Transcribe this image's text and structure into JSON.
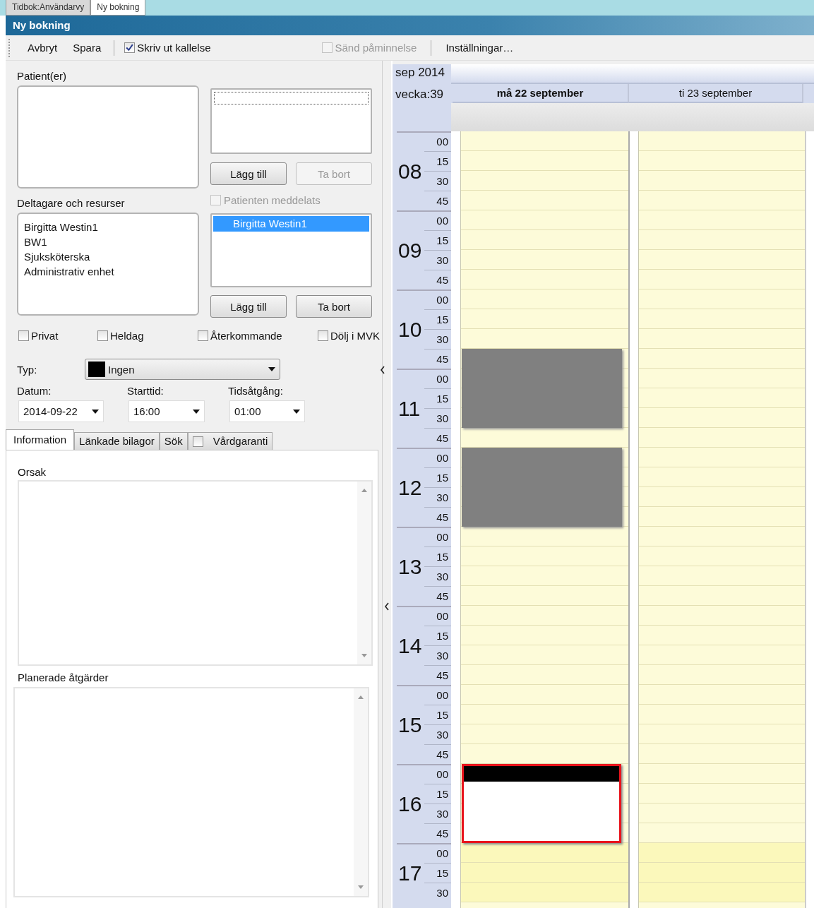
{
  "app_tabs": [
    {
      "label": "Tidbok:Användarvy",
      "selected": false
    },
    {
      "label": "Ny bokning",
      "selected": true
    }
  ],
  "window": {
    "title": "Ny bokning"
  },
  "toolbar": [
    {
      "kind": "button",
      "label": "Avbryt"
    },
    {
      "kind": "button",
      "label": "Spara"
    },
    {
      "kind": "separator"
    },
    {
      "kind": "checkbox",
      "label": "Skriv ut kallelse",
      "checked": true,
      "disabled": false
    },
    {
      "kind": "spacer"
    },
    {
      "kind": "checkbox",
      "label": "Sänd påminnelse",
      "checked": false,
      "disabled": true
    },
    {
      "kind": "separator"
    },
    {
      "kind": "button",
      "label": "Inställningar…"
    }
  ],
  "patients": {
    "label": "Patient(er)",
    "buttons": [
      {
        "label": "Lägg till",
        "disabled": false
      },
      {
        "label": "Ta bort",
        "disabled": true
      }
    ],
    "notified": {
      "label": "Patienten meddelats",
      "checked": false,
      "disabled": true
    }
  },
  "participants": {
    "label": "Deltagare och resurser",
    "details": [
      "Birgitta Westin1",
      "BW1",
      "Sjuksköterska",
      "Administrativ enhet"
    ],
    "list": [
      {
        "label": "Birgitta Westin1",
        "selected": true
      }
    ],
    "buttons": [
      {
        "label": "Lägg till",
        "disabled": false
      },
      {
        "label": "Ta bort",
        "disabled": false
      }
    ]
  },
  "options": [
    {
      "label": "Privat",
      "checked": false
    },
    {
      "label": "Heldag",
      "checked": false
    },
    {
      "label": "Återkommande",
      "checked": false
    },
    {
      "label": "Dölj i MVK",
      "checked": false
    }
  ],
  "type": {
    "label": "Typ:",
    "value": "Ingen",
    "color": "#000000"
  },
  "fields": [
    {
      "label": "Datum:",
      "value": "2014-09-22"
    },
    {
      "label": "Starttid:",
      "value": "16:00"
    },
    {
      "label": "Tidsåtgång:",
      "value": "01:00"
    }
  ],
  "detail_tabs": [
    {
      "kind": "tab",
      "label": "Information",
      "selected": true
    },
    {
      "kind": "tab",
      "label": "Länkade bilagor",
      "selected": false
    },
    {
      "kind": "tab",
      "label": "Sök",
      "selected": false
    },
    {
      "kind": "checkbox",
      "label": "Vårdgaranti",
      "selected": false,
      "checked": false
    }
  ],
  "text_areas": [
    {
      "label": "Orsak"
    },
    {
      "label": "Planerade åtgärder"
    }
  ],
  "calendar": {
    "month": "sep 2014",
    "week": "vecka:39",
    "days": [
      {
        "label": "må 22 september",
        "today": true,
        "slots": [
          {
            "kind": "free"
          },
          {
            "kind": "free"
          },
          {
            "kind": "free"
          },
          {
            "kind": "free"
          },
          {
            "kind": "free"
          },
          {
            "kind": "free"
          },
          {
            "kind": "free"
          },
          {
            "kind": "free"
          },
          {
            "kind": "free"
          },
          {
            "kind": "free"
          },
          {
            "kind": "free"
          },
          {
            "kind": "busy"
          },
          {
            "kind": "busy"
          },
          {
            "kind": "busy"
          },
          {
            "kind": "busy"
          },
          {
            "kind": "free"
          },
          {
            "kind": "busy"
          },
          {
            "kind": "busy"
          },
          {
            "kind": "busy"
          },
          {
            "kind": "busy"
          },
          {
            "kind": "free"
          },
          {
            "kind": "free"
          },
          {
            "kind": "free"
          },
          {
            "kind": "free"
          },
          {
            "kind": "free"
          },
          {
            "kind": "free"
          },
          {
            "kind": "free"
          },
          {
            "kind": "free"
          },
          {
            "kind": "free"
          },
          {
            "kind": "free"
          },
          {
            "kind": "free"
          },
          {
            "kind": "free"
          },
          {
            "kind": "booking"
          },
          {
            "kind": "booking"
          },
          {
            "kind": "booking"
          },
          {
            "kind": "booking"
          },
          {
            "kind": "free"
          },
          {
            "kind": "free"
          },
          {
            "kind": "free"
          }
        ]
      },
      {
        "label": "ti 23 september",
        "today": false,
        "slots": [
          {
            "kind": "free"
          },
          {
            "kind": "free"
          },
          {
            "kind": "free"
          },
          {
            "kind": "free"
          },
          {
            "kind": "free"
          },
          {
            "kind": "free"
          },
          {
            "kind": "free"
          },
          {
            "kind": "free"
          },
          {
            "kind": "free"
          },
          {
            "kind": "free"
          },
          {
            "kind": "free"
          },
          {
            "kind": "free"
          },
          {
            "kind": "free"
          },
          {
            "kind": "free"
          },
          {
            "kind": "free"
          },
          {
            "kind": "free"
          },
          {
            "kind": "free"
          },
          {
            "kind": "free"
          },
          {
            "kind": "free"
          },
          {
            "kind": "free"
          },
          {
            "kind": "free"
          },
          {
            "kind": "free"
          },
          {
            "kind": "free"
          },
          {
            "kind": "free"
          },
          {
            "kind": "free"
          },
          {
            "kind": "free"
          },
          {
            "kind": "free"
          },
          {
            "kind": "free"
          },
          {
            "kind": "free"
          },
          {
            "kind": "free"
          },
          {
            "kind": "free"
          },
          {
            "kind": "free"
          },
          {
            "kind": "free"
          },
          {
            "kind": "free"
          },
          {
            "kind": "free"
          },
          {
            "kind": "free"
          },
          {
            "kind": "free"
          },
          {
            "kind": "free"
          },
          {
            "kind": "free"
          }
        ]
      }
    ],
    "hours": [
      {
        "hour": "08",
        "minutes": [
          "00",
          "15",
          "30",
          "45"
        ],
        "evening": false
      },
      {
        "hour": "09",
        "minutes": [
          "00",
          "15",
          "30",
          "45"
        ],
        "evening": false
      },
      {
        "hour": "10",
        "minutes": [
          "00",
          "15",
          "30",
          "45"
        ],
        "evening": false
      },
      {
        "hour": "11",
        "minutes": [
          "00",
          "15",
          "30",
          "45"
        ],
        "evening": false
      },
      {
        "hour": "12",
        "minutes": [
          "00",
          "15",
          "30",
          "45"
        ],
        "evening": false
      },
      {
        "hour": "13",
        "minutes": [
          "00",
          "15",
          "30",
          "45"
        ],
        "evening": false
      },
      {
        "hour": "14",
        "minutes": [
          "00",
          "15",
          "30",
          "45"
        ],
        "evening": false
      },
      {
        "hour": "15",
        "minutes": [
          "00",
          "15",
          "30",
          "45"
        ],
        "evening": false
      },
      {
        "hour": "16",
        "minutes": [
          "00",
          "15",
          "30",
          "45"
        ],
        "evening": false
      },
      {
        "hour": "17",
        "minutes": [
          "00",
          "15",
          "30"
        ],
        "evening": true
      }
    ]
  }
}
